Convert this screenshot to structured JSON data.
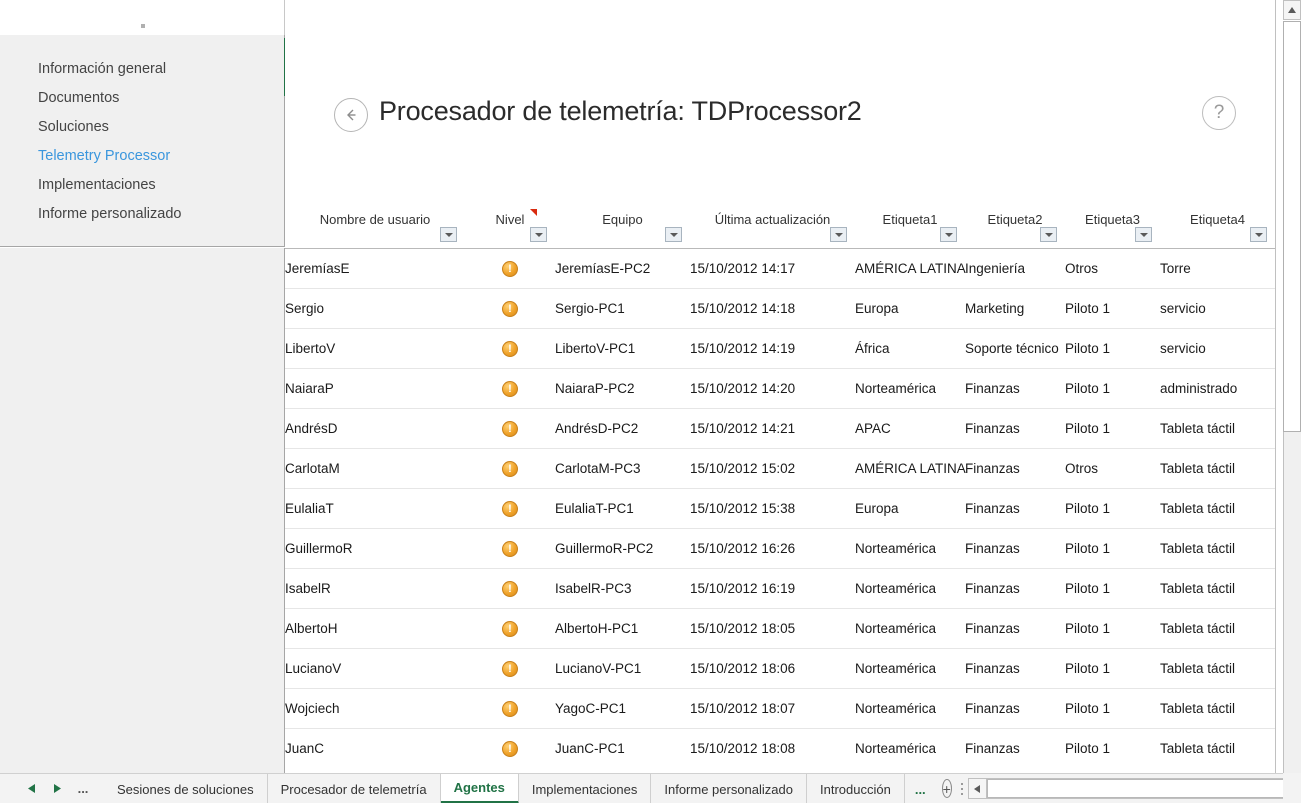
{
  "sidebar": {
    "items": [
      {
        "label": "Información general",
        "active": false
      },
      {
        "label": "Documentos",
        "active": false
      },
      {
        "label": "Soluciones",
        "active": false
      },
      {
        "label": "Telemetry Processor",
        "active": true
      },
      {
        "label": "Implementaciones",
        "active": false
      },
      {
        "label": "Informe personalizado",
        "active": false
      }
    ],
    "active_color": "#3a96dd"
  },
  "header": {
    "title": "Procesador de telemetría: TDProcessor2",
    "back_icon": "back-arrow-icon",
    "help_icon": "question-mark-icon"
  },
  "table": {
    "columns": [
      "Nombre de usuario",
      "Nivel",
      "Equipo",
      "Última actualización",
      "Etiqueta1",
      "Etiqueta2",
      "Etiqueta3",
      "Etiqueta4"
    ],
    "level_icon": "warning-icon",
    "rows": [
      {
        "user": "JeremíasE",
        "machine": "JeremíasE-PC2",
        "updated": "15/10/2012 14:17",
        "tag1": "AMÉRICA LATINA",
        "tag2": "Ingeniería",
        "tag3": "Otros",
        "tag4": "Torre"
      },
      {
        "user": "Sergio",
        "machine": "Sergio-PC1",
        "updated": "15/10/2012 14:18",
        "tag1": "Europa",
        "tag2": "Marketing",
        "tag3": "Piloto 1",
        "tag4": "servicio"
      },
      {
        "user": "LibertoV",
        "machine": "LibertoV-PC1",
        "updated": "15/10/2012 14:19",
        "tag1": "África",
        "tag2": "Soporte técnico",
        "tag3": "Piloto 1",
        "tag4": "servicio"
      },
      {
        "user": "NaiaraP",
        "machine": "NaiaraP-PC2",
        "updated": "15/10/2012 14:20",
        "tag1": "Norteamérica",
        "tag2": "Finanzas",
        "tag3": "Piloto 1",
        "tag4": "administrado"
      },
      {
        "user": "AndrésD",
        "machine": "AndrésD-PC2",
        "updated": "15/10/2012 14:21",
        "tag1": "APAC",
        "tag2": "Finanzas",
        "tag3": "Piloto 1",
        "tag4": "Tableta táctil"
      },
      {
        "user": "CarlotaM",
        "machine": "CarlotaM-PC3",
        "updated": "15/10/2012 15:02",
        "tag1": "AMÉRICA LATINA",
        "tag2": "Finanzas",
        "tag3": "Otros",
        "tag4": "Tableta táctil"
      },
      {
        "user": "EulaliaT",
        "machine": "EulaliaT-PC1",
        "updated": "15/10/2012 15:38",
        "tag1": "Europa",
        "tag2": "Finanzas",
        "tag3": "Piloto 1",
        "tag4": "Tableta táctil"
      },
      {
        "user": "GuillermoR",
        "machine": "GuillermoR-PC2",
        "updated": "15/10/2012 16:26",
        "tag1": "Norteamérica",
        "tag2": "Finanzas",
        "tag3": "Piloto 1",
        "tag4": "Tableta táctil"
      },
      {
        "user": "IsabelR",
        "machine": "IsabelR-PC3",
        "updated": "15/10/2012 16:19",
        "tag1": "Norteamérica",
        "tag2": "Finanzas",
        "tag3": "Piloto 1",
        "tag4": "Tableta táctil"
      },
      {
        "user": "AlbertoH",
        "machine": "AlbertoH-PC1",
        "updated": "15/10/2012 18:05",
        "tag1": "Norteamérica",
        "tag2": "Finanzas",
        "tag3": "Piloto 1",
        "tag4": "Tableta táctil"
      },
      {
        "user": "LucianoV",
        "machine": "LucianoV-PC1",
        "updated": "15/10/2012 18:06",
        "tag1": "Norteamérica",
        "tag2": "Finanzas",
        "tag3": "Piloto 1",
        "tag4": "Tableta táctil"
      },
      {
        "user": "Wojciech",
        "machine": "YagoC-PC1",
        "updated": "15/10/2012 18:07",
        "tag1": "Norteamérica",
        "tag2": "Finanzas",
        "tag3": "Piloto 1",
        "tag4": "Tableta táctil"
      },
      {
        "user": "JuanC",
        "machine": "JuanC-PC1",
        "updated": "15/10/2012 18:08",
        "tag1": "Norteamérica",
        "tag2": "Finanzas",
        "tag3": "Piloto 1",
        "tag4": "Tableta táctil"
      }
    ]
  },
  "tabbar": {
    "prev_icon": "triangle-left-icon",
    "next_icon": "triangle-right-icon",
    "overflow_left": "...",
    "overflow_right": "...",
    "add_icon": "plus-circle-icon",
    "tabs": [
      {
        "label": "Sesiones de soluciones",
        "active": false
      },
      {
        "label": "Procesador de telemetría",
        "active": false
      },
      {
        "label": "Agentes",
        "active": true
      },
      {
        "label": "Implementaciones",
        "active": false
      },
      {
        "label": "Informe personalizado",
        "active": false
      },
      {
        "label": "Introducción",
        "active": false
      }
    ],
    "active_color": "#217346"
  },
  "scrollbars": {
    "v_up_icon": "triangle-up-icon",
    "h_left_icon": "triangle-left-icon",
    "h_right_icon": "triangle-right-icon"
  }
}
